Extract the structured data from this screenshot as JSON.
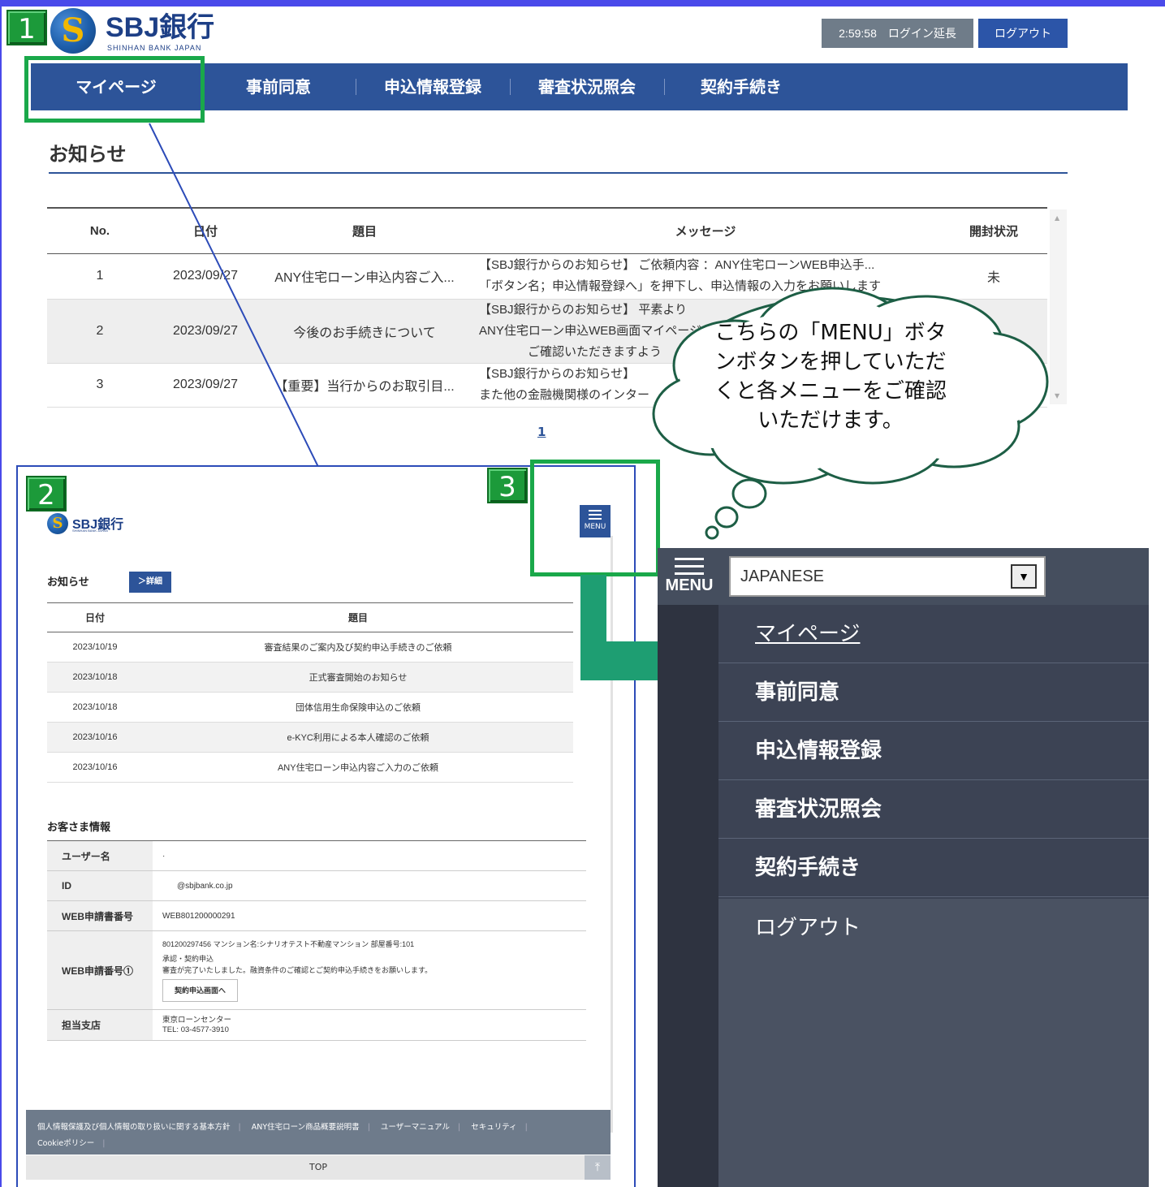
{
  "badges": {
    "b1": "1",
    "b2": "2",
    "b3": "3"
  },
  "brand": {
    "name": "SBJ銀行",
    "sub": "SHINHAN BANK JAPAN",
    "logo_letter": "S",
    "color": "#1d3f86"
  },
  "header": {
    "session_button": "2:59:58　ログイン延長",
    "logout_button": "ログアウト"
  },
  "nav": {
    "items": [
      "マイページ",
      "事前同意",
      "申込情報登録",
      "審査状況照会",
      "契約手続き"
    ]
  },
  "notice": {
    "title": "お知らせ",
    "columns": [
      "No.",
      "日付",
      "題目",
      "メッセージ",
      "開封状況"
    ],
    "rows": [
      {
        "no": "1",
        "date": "2023/09/27",
        "subject": "ANY住宅ローン申込内容ご入...",
        "msg1": "【SBJ銀行からのお知らせ】 ご依頼内容 ：ANY住宅ローンWEB申込手...",
        "msg2": "「ボタン名；申込情報登録へ」を押下し、申込情報の入力をお願いします",
        "status": "未"
      },
      {
        "no": "2",
        "date": "2023/09/27",
        "subject": "今後のお手続きについて",
        "msg1": "【SBJ銀行からのお知らせ】 平素より",
        "msg2": "ANY住宅ローン申込WEB画面マイページ",
        "msg3": "ご確認いただきますよう",
        "status": ""
      },
      {
        "no": "3",
        "date": "2023/09/27",
        "subject": "【重要】当行からのお取引目...",
        "msg1": "【SBJ銀行からのお知らせ】",
        "msg2": "また他の金融機関様のインター",
        "status": ""
      }
    ],
    "page": "1"
  },
  "callout": {
    "text": "こちらの「MENU」ボタンボタンを押していただくと各メニューをご確認いただけます。"
  },
  "mobile": {
    "brand": "SBJ銀行",
    "brand_sub": "SHINHAN BANK JAPAN",
    "menu_label": "MENU",
    "notice_title": "お知らせ",
    "detail_button": "＞詳細",
    "columns": [
      "日付",
      "題目"
    ],
    "rows": [
      {
        "date": "2023/10/19",
        "subject": "審査結果のご案内及び契約申込手続きのご依頼"
      },
      {
        "date": "2023/10/18",
        "subject": "正式審査開始のお知らせ"
      },
      {
        "date": "2023/10/18",
        "subject": "団体信用生命保険申込のご依頼"
      },
      {
        "date": "2023/10/16",
        "subject": "e-KYC利用による本人確認のご依頼"
      },
      {
        "date": "2023/10/16",
        "subject": "ANY住宅ローン申込内容ご入力のご依頼"
      }
    ],
    "customer_title": "お客さま情報",
    "info": {
      "user_label": "ユーザー名",
      "user_value": "·",
      "id_label": "ID",
      "id_value": "@sbjbank.co.jp",
      "web_label": "WEB申請書番号",
      "web_value": "WEB801200000291",
      "web2_label": "WEB申請番号①",
      "web2_line1": "801200297456 マンション名:シナリオテスト不動産マンション 部屋番号:101",
      "web2_line2": "承認・契約申込",
      "web2_line3": "審査が完了いたしました。融資条件のご確認とご契約申込手続きをお願いします。",
      "web2_button": "契約申込画面へ",
      "branch_label": "担当支店",
      "branch_value1": "東京ローンセンター",
      "branch_value2": "TEL: 03-4577-3910"
    },
    "footer_links": [
      "個人情報保護及び個人情報の取り扱いに関する基本方針",
      "ANY住宅ローン商品概要説明書",
      "ユーザーマニュアル",
      "セキュリティ",
      "Cookieポリシー"
    ],
    "top_label": "TOP"
  },
  "menu_panel": {
    "menu_label": "MENU",
    "language": "JAPANESE",
    "items": [
      "マイページ",
      "事前同意",
      "申込情報登録",
      "審査状況照会",
      "契約手続き",
      "ログアウト"
    ]
  },
  "colors": {
    "nav_bg": "#2d5499",
    "highlight": "#1aa84a",
    "panel_bg": "#4a5262",
    "arrow": "#1e9e72",
    "cloud_stroke": "#1d5e45"
  }
}
